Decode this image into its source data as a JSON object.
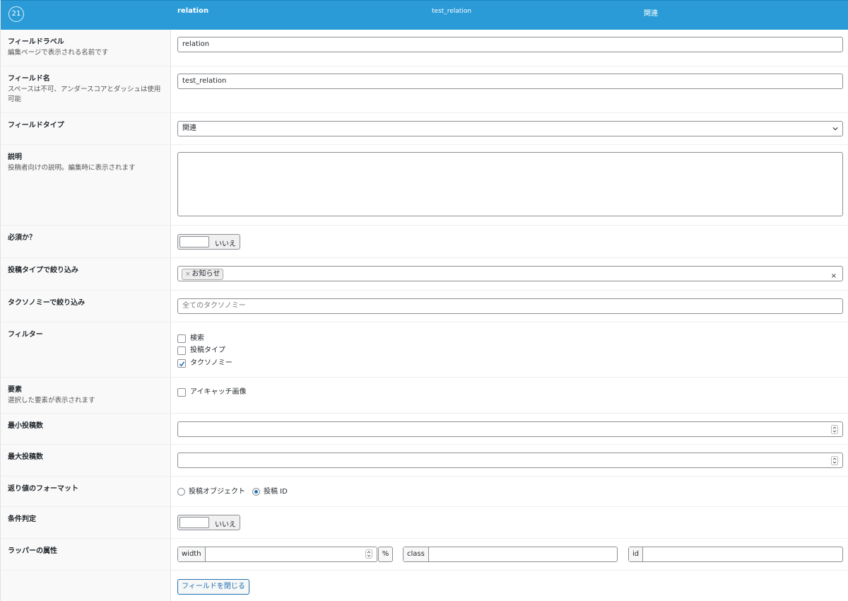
{
  "header": {
    "order": "21",
    "label": "relation",
    "name": "test_relation",
    "type": "関連"
  },
  "fields": {
    "label": {
      "title": "フィールドラベル",
      "desc": "編集ページで表示される名前です",
      "value": "relation"
    },
    "name": {
      "title": "フィールド名",
      "desc": "スペースは不可、アンダースコアとダッシュは使用可能",
      "value": "test_relation"
    },
    "type": {
      "title": "フィールドタイプ",
      "value": "関連"
    },
    "instructions": {
      "title": "説明",
      "desc": "投稿者向けの説明。編集時に表示されます",
      "value": ""
    },
    "required": {
      "title": "必須か？",
      "toggle_label": "いいえ"
    },
    "post_type": {
      "title": "投稿タイプで絞り込み",
      "tags": [
        "お知らせ"
      ],
      "tag_remove": "×",
      "clear": "×"
    },
    "taxonomy": {
      "title": "タクソノミーで絞り込み",
      "placeholder": "全てのタクソノミー"
    },
    "filters": {
      "title": "フィルター",
      "options": [
        {
          "label": "検索",
          "checked": false
        },
        {
          "label": "投稿タイプ",
          "checked": false
        },
        {
          "label": "タクソノミー",
          "checked": true
        }
      ]
    },
    "elements": {
      "title": "要素",
      "desc": "選択した要素が表示されます",
      "options": [
        {
          "label": "アイキャッチ画像",
          "checked": false
        }
      ]
    },
    "min": {
      "title": "最小投稿数",
      "value": ""
    },
    "max": {
      "title": "最大投稿数",
      "value": ""
    },
    "return_format": {
      "title": "返り値のフォーマット",
      "options": [
        {
          "label": "投稿オブジェクト",
          "selected": false
        },
        {
          "label": "投稿 ID",
          "selected": true
        }
      ]
    },
    "conditional": {
      "title": "条件判定",
      "toggle_label": "いいえ"
    },
    "wrapper": {
      "title": "ラッパーの属性",
      "width_label": "width",
      "width_unit": "%",
      "class_label": "class",
      "id_label": "id"
    }
  },
  "footer": {
    "close_button": "フィールドを閉じる"
  },
  "colors": {
    "header_bg": "#2a9bd7",
    "accent": "#2271b1"
  }
}
